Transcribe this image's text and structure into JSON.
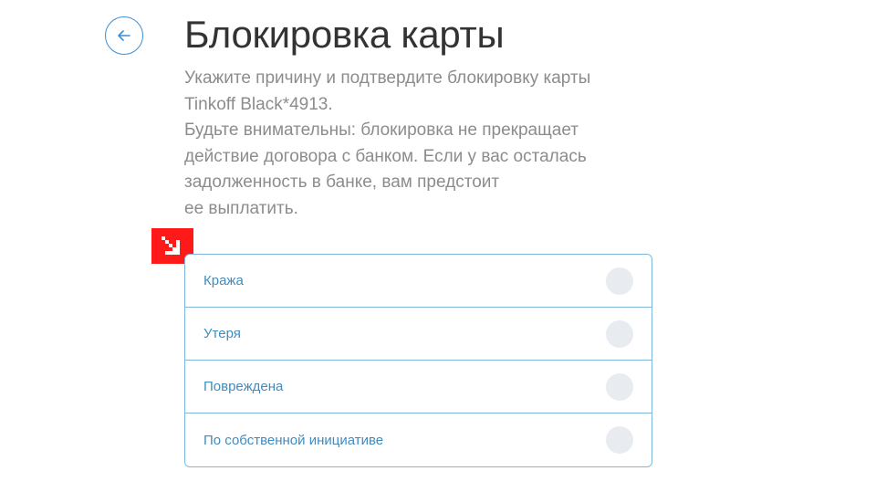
{
  "header": {
    "back_icon": "arrow-left-icon",
    "title": "Блокировка карты"
  },
  "description": {
    "lines": [
      "Укажите причину и подтвердите блокировку карты",
      "Tinkoff Black*4913.",
      "Будьте внимательны: блокировка не прекращает",
      "действие договора с банком. Если у вас осталась",
      "задолженность в банке, вам предстоит",
      "ее выплатить."
    ]
  },
  "marker": {
    "icon": "arrow-down-right-icon",
    "color": "#ff1a1a"
  },
  "reasons": {
    "options": [
      {
        "label": "Кража",
        "selected": false
      },
      {
        "label": "Утеря",
        "selected": false
      },
      {
        "label": "Повреждена",
        "selected": false
      },
      {
        "label": "По собственной инициативе",
        "selected": false
      }
    ]
  },
  "colors": {
    "accent": "#3d8fd4",
    "border": "#7fb8dc",
    "option_text": "#3f8cc0",
    "description_text": "#8c8c8c",
    "title_text": "#333333",
    "radio_fill": "#e8ecf0"
  }
}
